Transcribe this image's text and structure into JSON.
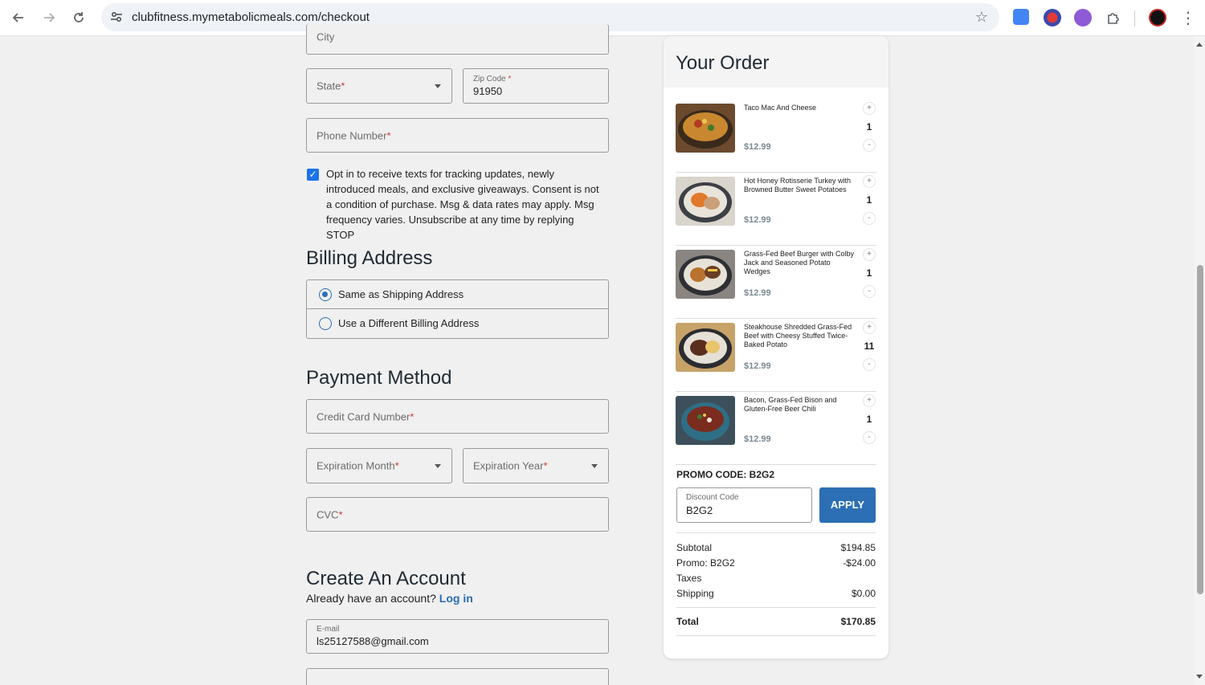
{
  "browser": {
    "url": "clubfitness.mymetabolicmeals.com/checkout",
    "icons": [
      "back-icon",
      "forward-icon",
      "reload-icon",
      "site-info-icon",
      "bookmark-star-icon",
      "translate-extension-icon",
      "extension-icon",
      "extension-icon",
      "puzzle-extensions-icon",
      "profile-avatar-icon",
      "menu-dots-icon"
    ]
  },
  "form": {
    "city_placeholder": "City",
    "state_placeholder": "State",
    "zip_label": "Zip Code",
    "zip_value": "91950",
    "phone_placeholder": "Phone Number",
    "required_mark": "*",
    "optin_text": "Opt in to receive texts for tracking updates, newly introduced meals, and exclusive giveaways. Consent is not a condition of purchase. Msg & data rates may apply. Msg frequency varies. Unsubscribe at any time by replying STOP",
    "optin_checked": true,
    "billing_heading": "Billing Address",
    "billing_options": [
      "Same as Shipping Address",
      "Use a Different Billing Address"
    ],
    "billing_selected": 0,
    "payment_heading": "Payment Method",
    "card_placeholder": "Credit Card Number",
    "exp_month_placeholder": "Expiration Month",
    "exp_year_placeholder": "Expiration Year",
    "cvc_placeholder": "CVC",
    "account_heading": "Create An Account",
    "account_prompt": "Already have an account?",
    "login_link": "Log in",
    "email_label": "E-mail",
    "email_value": "ls25127588@gmail.com"
  },
  "order": {
    "title": "Your Order",
    "items": [
      {
        "name": "Taco Mac And Cheese",
        "price": "$12.99",
        "qty": "1"
      },
      {
        "name": "Hot Honey Rotisserie Turkey with Browned Butter Sweet Potatoes",
        "price": "$12.99",
        "qty": "1"
      },
      {
        "name": "Grass-Fed Beef Burger with Colby Jack and Seasoned Potato Wedges",
        "price": "$12.99",
        "qty": "1"
      },
      {
        "name": "Steakhouse Shredded Grass-Fed Beef with Cheesy Stuffed Twice-Baked Potato",
        "price": "$12.99",
        "qty": "11"
      },
      {
        "name": "Bacon, Grass-Fed Bison and Gluten-Free Beer Chili",
        "price": "$12.99",
        "qty": "1"
      }
    ],
    "plus_symbol": "+",
    "minus_symbol": "-",
    "promo_title": "PROMO CODE: B2G2",
    "discount_label": "Discount Code",
    "discount_value": "B2G2",
    "apply_label": "APPLY",
    "summary": {
      "subtotal_label": "Subtotal",
      "subtotal": "$194.85",
      "promo_label": "Promo: B2G2",
      "promo": "-$24.00",
      "taxes_label": "Taxes",
      "shipping_label": "Shipping",
      "shipping": "$0.00",
      "total_label": "Total",
      "total": "$170.85"
    }
  },
  "colors": {
    "accent": "#2c6fb5",
    "checkbox": "#1a73e8",
    "required": "#d23b3b",
    "price": "#7a8a93"
  }
}
